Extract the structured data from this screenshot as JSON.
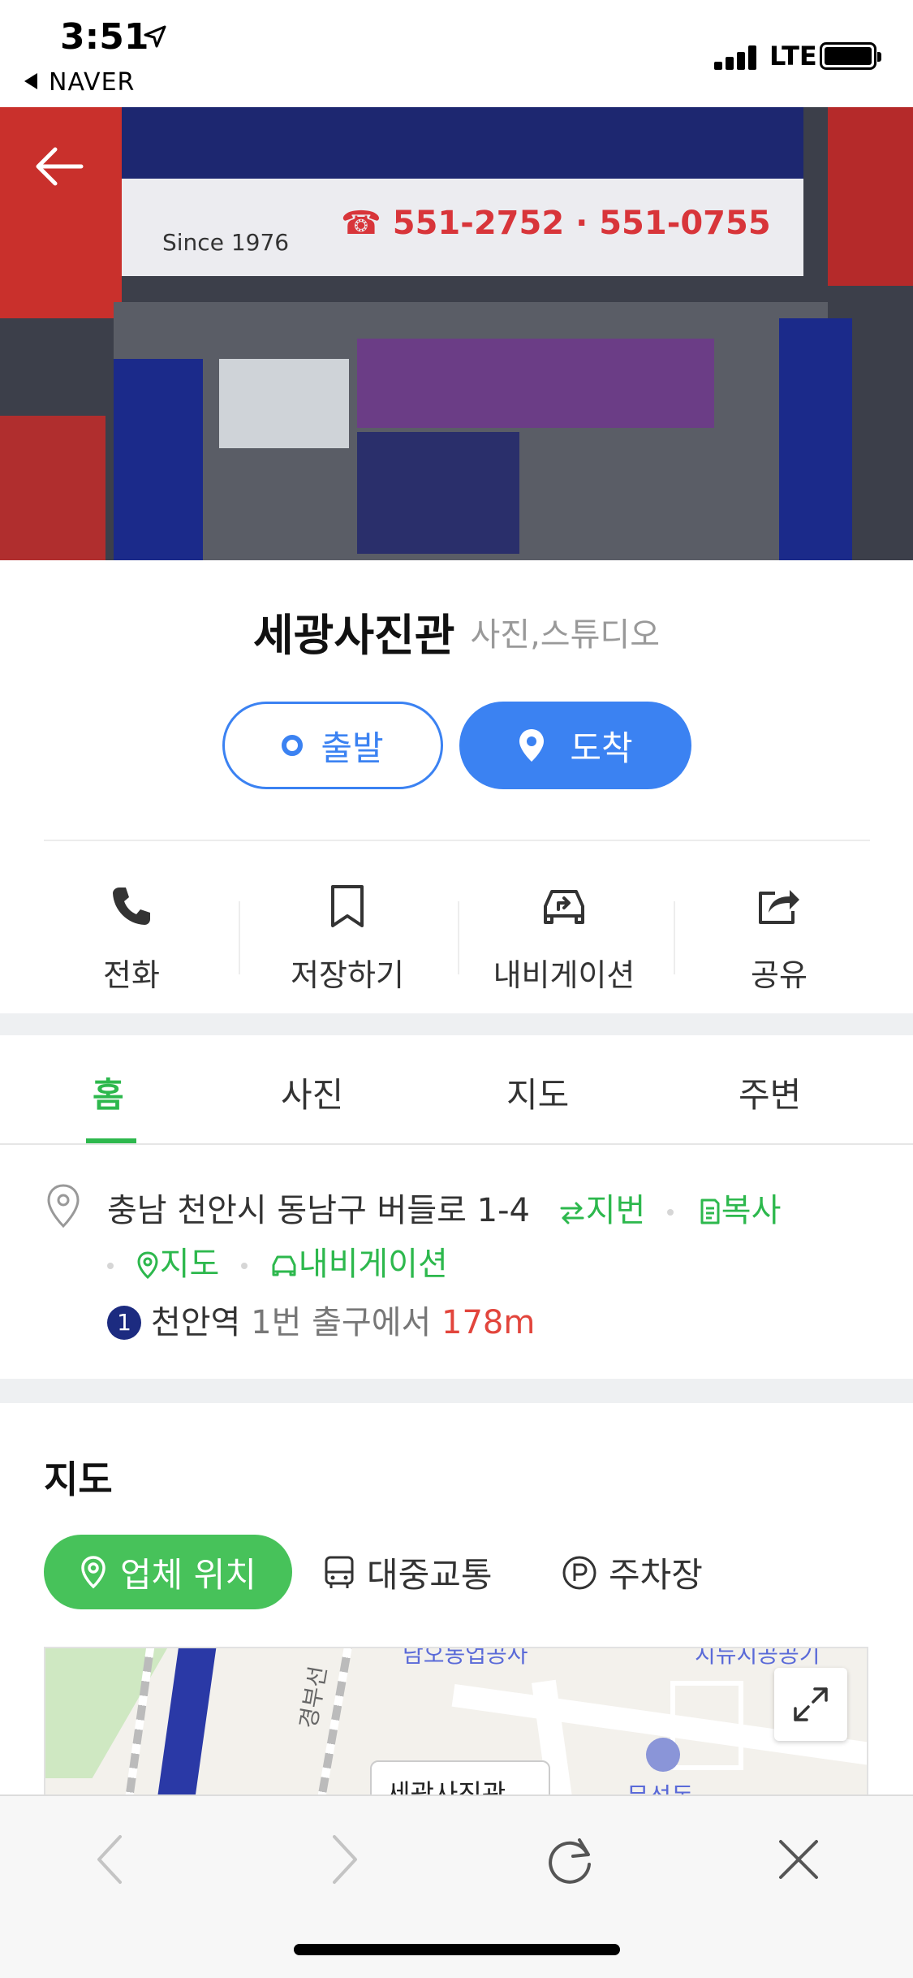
{
  "status_bar": {
    "time": "3:51",
    "back_app": "NAVER",
    "network": "LTE"
  },
  "hero": {
    "sign_since": "Since 1976",
    "sign_phone": "☎ 551-2752 · 551-0755"
  },
  "place": {
    "name": "세광사진관",
    "category": "사진,스튜디오",
    "depart_label": "출발",
    "arrive_label": "도착"
  },
  "actions": [
    {
      "label": "전화",
      "icon": "phone-icon"
    },
    {
      "label": "저장하기",
      "icon": "bookmark-icon"
    },
    {
      "label": "내비게이션",
      "icon": "car-navigation-icon"
    },
    {
      "label": "공유",
      "icon": "share-icon"
    }
  ],
  "tabs": [
    {
      "label": "홈",
      "active": true
    },
    {
      "label": "사진",
      "active": false
    },
    {
      "label": "지도",
      "active": false
    },
    {
      "label": "주변",
      "active": false
    }
  ],
  "address": {
    "road_address": "충남 천안시 동남구 버들로 1-4",
    "lot_number_link": "지번",
    "copy_link": "복사",
    "map_link": "지도",
    "navigation_link": "내비게이션",
    "subway_line": "1",
    "station": "천안역",
    "exit_text": "1번 출구에서",
    "distance": "178m"
  },
  "map_section": {
    "title": "지도",
    "chips": [
      "업체 위치",
      "대중교통",
      "주차장"
    ],
    "map_labels": {
      "top_left": "남오동업공사",
      "top_right": "지뉴지공공기",
      "rail_line": "경부선",
      "marker": "세광사진관",
      "gov": "문성동"
    }
  },
  "colors": {
    "accent_blue": "#3b82f2",
    "accent_green": "#2db84d",
    "distance_red": "#e2453c"
  }
}
